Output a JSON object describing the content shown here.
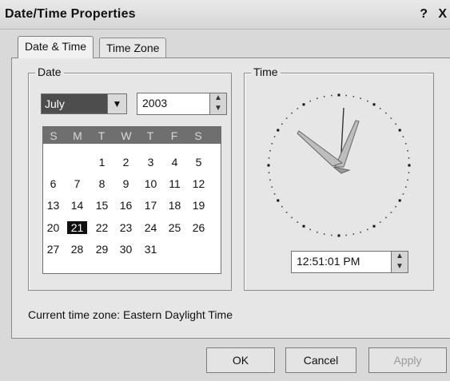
{
  "window": {
    "title": "Date/Time Properties",
    "help": "?",
    "close": "X"
  },
  "tabs": [
    {
      "label": "Date & Time",
      "active": true
    },
    {
      "label": "Time Zone",
      "active": false
    }
  ],
  "date_group": {
    "label": "Date",
    "month": "July",
    "year": "2003",
    "weekdays": [
      "S",
      "M",
      "T",
      "W",
      "T",
      "F",
      "S"
    ],
    "days": [
      [
        "",
        "",
        "1",
        "2",
        "3",
        "4",
        "5"
      ],
      [
        "6",
        "7",
        "8",
        "9",
        "10",
        "11",
        "12"
      ],
      [
        "13",
        "14",
        "15",
        "16",
        "17",
        "18",
        "19"
      ],
      [
        "20",
        "21",
        "22",
        "23",
        "24",
        "25",
        "26"
      ],
      [
        "27",
        "28",
        "29",
        "30",
        "31",
        "",
        ""
      ]
    ],
    "selected_day": "21"
  },
  "time_group": {
    "label": "Time",
    "time": "12:51:01 PM"
  },
  "timezone_text": "Current time zone:  Eastern Daylight Time",
  "buttons": {
    "ok": "OK",
    "cancel": "Cancel",
    "apply": "Apply"
  }
}
